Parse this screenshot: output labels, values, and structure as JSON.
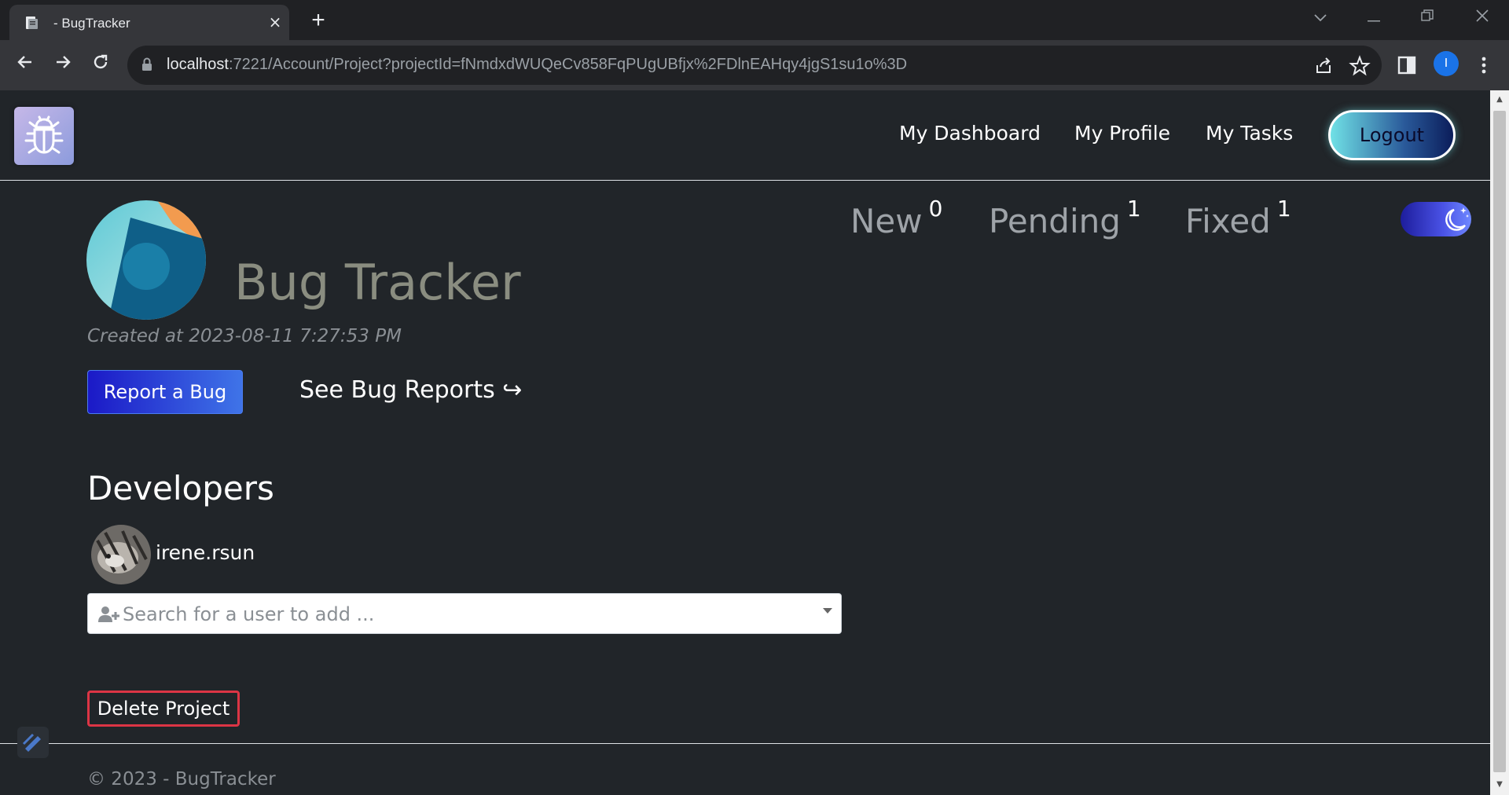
{
  "browser": {
    "tab_title": "- BugTracker",
    "tab_close": "×",
    "new_tab": "+",
    "url_host": "localhost",
    "url_rest": ":7221/Account/Project?projectId=fNmdxdWUQeCv858FqPUgUBfjx%2FDlnEAHqy4jgS1su1o%3D",
    "profile_initial": "I"
  },
  "nav": {
    "links": [
      "My Dashboard",
      "My Profile",
      "My Tasks"
    ],
    "logout_label": "Logout"
  },
  "stats": [
    {
      "label": "New",
      "count": "0"
    },
    {
      "label": "Pending",
      "count": "1"
    },
    {
      "label": "Fixed",
      "count": "1"
    }
  ],
  "project": {
    "title": "Bug Tracker",
    "created": "Created at 2023-08-11 7:27:53 PM"
  },
  "actions": {
    "report_bug": "Report a Bug",
    "see_reports": "See Bug Reports ↪"
  },
  "developers": {
    "heading": "Developers",
    "members": [
      {
        "username": "irene.rsun"
      }
    ],
    "search_placeholder": "Search for a user to add ..."
  },
  "danger": {
    "delete_label": "Delete Project"
  },
  "footer": {
    "text": "© 2023 - BugTracker"
  },
  "colors": {
    "page_bg": "#212529",
    "delete_border": "#dc3545",
    "report_gradient_start": "#1b19c7",
    "report_gradient_end": "#3f74e8"
  },
  "icons": [
    "document-favicon-icon",
    "close-icon",
    "plus-icon",
    "back-arrow-icon",
    "forward-arrow-icon",
    "reload-icon",
    "lock-icon",
    "share-icon",
    "star-icon",
    "side-panel-icon",
    "kebab-menu-icon",
    "bug-logo-icon",
    "moon-stars-icon",
    "add-user-icon",
    "chevron-down-icon",
    "scroll-up-icon",
    "scroll-down-icon"
  ]
}
